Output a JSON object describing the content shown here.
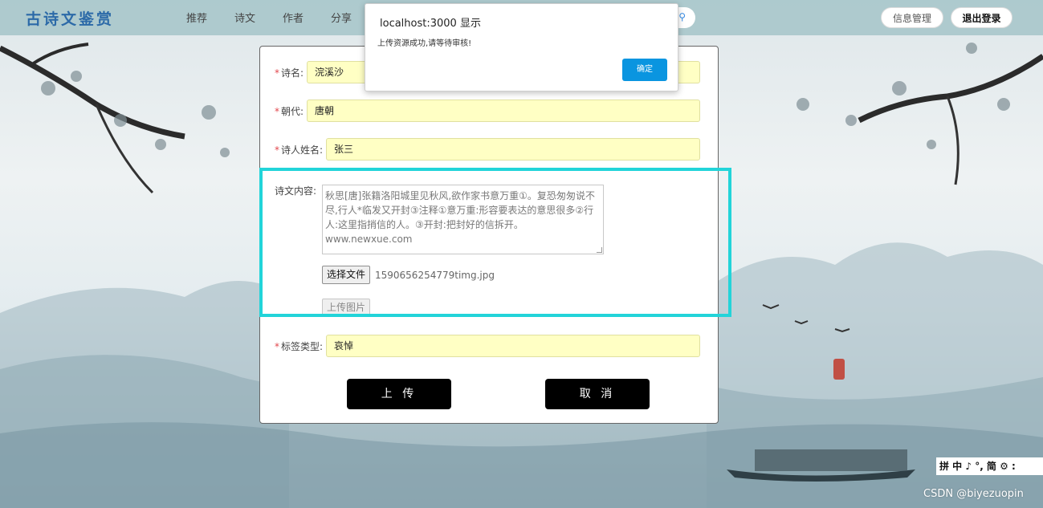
{
  "header": {
    "logo": "古诗文鉴赏",
    "nav": [
      "推荐",
      "诗文",
      "作者",
      "分享"
    ],
    "buttons": {
      "info": "信息管理",
      "logout": "退出登录"
    }
  },
  "form": {
    "name": {
      "label": "诗名:",
      "value": "浣溪沙"
    },
    "dynasty": {
      "label": "朝代:",
      "value": "唐朝"
    },
    "author": {
      "label": "诗人姓名:",
      "value": "张三"
    },
    "content": {
      "label": "诗文内容:",
      "value": "秋思[唐]张籍洛阳城里见秋风,欲作家书意万重①。复恐匆匆说不尽,行人*临发又开封③注释①意万重:形容要表达的意思很多②行人:这里指捎信的人。③开封:把封好的信拆开。www.newxue.com"
    },
    "file": {
      "button": "选择文件",
      "name": "1590656254779timg.jpg"
    },
    "upload_image_button": "上传图片",
    "tag": {
      "label": "标签类型:",
      "value": "哀悼"
    },
    "actions": {
      "submit": "上 传",
      "cancel": "取 消"
    }
  },
  "dialog": {
    "title": "localhost:3000 显示",
    "message": "上传资源成功,请等待审核!",
    "ok": "确定"
  },
  "ime_toolbar": "拼 中 ♪ °, 简 ⚙ :",
  "watermark": "CSDN @biyezuopin",
  "colors": {
    "accent": "#22d4d9",
    "dialog_button": "#0a95e0",
    "field_bg": "#ffffc4",
    "required": "#e2474d"
  }
}
